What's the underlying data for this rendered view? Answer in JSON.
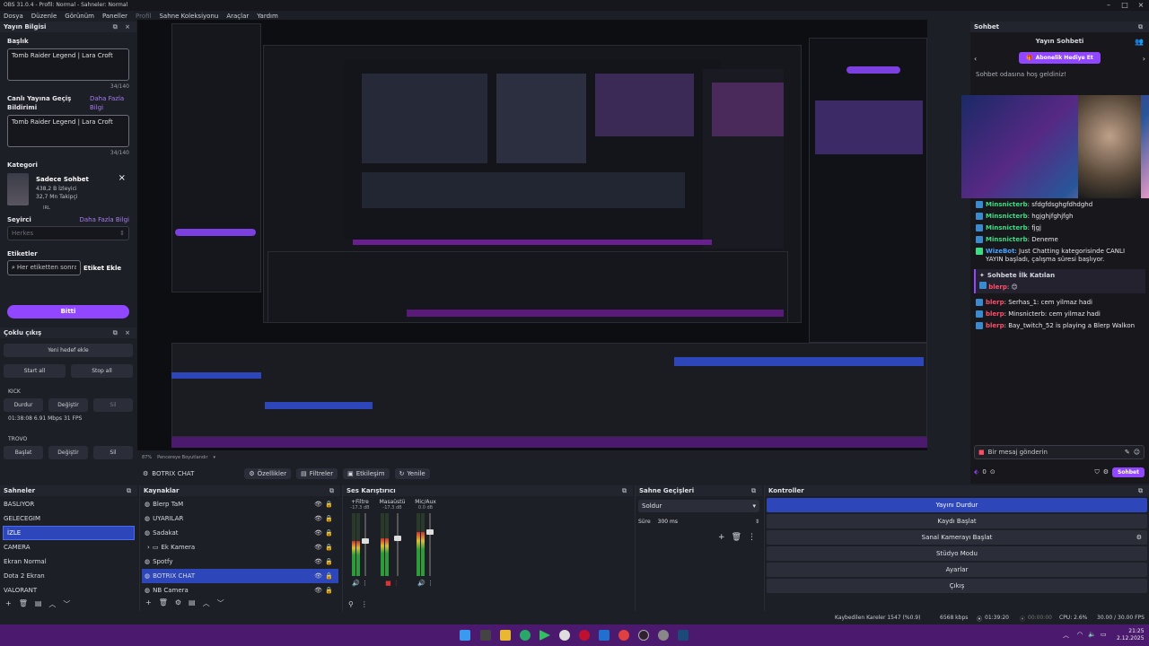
{
  "window": {
    "title": "OBS 31.0.4 - Profil: Normal - Sahneler: Normal"
  },
  "menu": [
    "Dosya",
    "Düzenle",
    "Görünüm",
    "Paneller",
    "Profil",
    "Sahne Koleksiyonu",
    "Araçlar",
    "Yardım"
  ],
  "stream_info": {
    "header": "Yayın Bilgisi",
    "title_label": "Başlık",
    "title_value": "Tomb Raider Legend | Lara Croft",
    "title_count": "34/140",
    "live_label": "Canlı Yayına Geçiş Bildirimi",
    "live_link": "Daha Fazla Bilgi",
    "live_value": "Tomb Raider Legend | Lara Croft",
    "live_count": "34/140",
    "category_label": "Kategori",
    "category_name": "Sadece Sohbet",
    "category_viewers": "438,2 B İzleyici",
    "category_followers": "32,7 Mn Takipçi",
    "category_tag": "IRL",
    "audience_label": "Seyirci",
    "audience_link": "Daha Fazla Bilgi",
    "audience_value": "Herkes",
    "tags_label": "Etiketler",
    "tags_placeholder": "Her etiketten sonra",
    "tags_button": "Etiket Ekle",
    "done_button": "Bitti"
  },
  "multi_output": {
    "header": "Çoklu çıkış",
    "add_target": "Yeni hedef ekle",
    "start_all": "Start all",
    "stop_all": "Stop all",
    "kick_label": "KICK",
    "kick_stop": "Durdur",
    "kick_change": "Değiştir",
    "kick_delete": "Sil",
    "kick_stats": "01:38:08  6.91 Mbps  31 FPS",
    "trovo_label": "TROVO",
    "trovo_start": "Başlat",
    "trovo_change": "Değiştir",
    "trovo_delete": "Sil"
  },
  "preview": {
    "zoom": "87%",
    "zoom_label": "Pencereye Boyutlandır"
  },
  "source_toolbar": {
    "selected_source": "BOTRIX CHAT",
    "properties": "Özellikler",
    "filters": "Filtreler",
    "interact": "Etkileşim",
    "refresh": "Yenile"
  },
  "scenes": {
    "header": "Sahneler",
    "items": [
      "BASLIYOR",
      "GELECEGIM",
      "İZLE",
      "CAMERA",
      "Ekran Normal",
      "Dota 2 Ekran",
      "VALORANT"
    ],
    "selected": 2
  },
  "sources": {
    "header": "Kaynaklar",
    "items": [
      "Blerp TaM",
      "UYARILAR",
      "Sadakat",
      "Ek Kamera",
      "Spotfy",
      "BOTRIX CHAT",
      "NB Camera"
    ],
    "selected": 5
  },
  "mixer": {
    "header": "Ses Karıştırıcı",
    "channels": [
      {
        "name": "+Filtre",
        "db": "-17.3 dB",
        "level": 0.55
      },
      {
        "name": "Masaüstü",
        "db": "-17.3 dB",
        "level": 0.6
      },
      {
        "name": "Mic/Aux",
        "db": "0.0 dB",
        "level": 0.7
      }
    ]
  },
  "transitions": {
    "header": "Sahne Geçişleri",
    "type": "Soldur",
    "duration_label": "Süre",
    "duration_value": "300 ms"
  },
  "controls": {
    "header": "Kontroller",
    "buttons": [
      "Yayını Durdur",
      "Kaydı Başlat",
      "Sanal Kamerayı Başlat",
      "Stüdyo Modu",
      "Ayarlar",
      "Çıkış"
    ]
  },
  "chat": {
    "header": "Sohbet",
    "title": "Yayın Sohbeti",
    "gift_button": "Abonelik Hediye Et",
    "welcome": "Sohbet odasına hoş geldiniz!",
    "messages": [
      {
        "user": "Minsnicterb",
        "text": "sfdgfdsghgfdhdghd",
        "color": "#3ddc84"
      },
      {
        "user": "Minsnicterb",
        "text": "hgjghjfghjfgh",
        "color": "#3ddc84"
      },
      {
        "user": "Minsnicterb",
        "text": "fjgj",
        "color": "#3ddc84"
      },
      {
        "user": "Minsnicterb",
        "text": "Deneme",
        "color": "#3ddc84"
      },
      {
        "user": "WizeBot",
        "text": "Just Chatting kategorisinde CANLI YAYIN başladı, çalışma süresi başlıyor.",
        "color": "#4aa3ff"
      }
    ],
    "first_join_label": "Sohbete İlk Katılan",
    "first_join_user": "blerp",
    "messages2": [
      {
        "user": "blerp",
        "text": "Serhas_1: cem yilmaz hadi",
        "color": "#ff4d6a"
      },
      {
        "user": "blerp",
        "text": "Minsnicterb: cem yilmaz hadi",
        "color": "#ff4d6a"
      },
      {
        "user": "blerp",
        "text": "Bay_twitch_52 is playing a Blerp Walkon",
        "color": "#ff4d6a"
      }
    ],
    "input_placeholder": "Bir mesaj gönderin",
    "points": "0",
    "send_button": "Sohbet"
  },
  "status": {
    "dropped": "Kaybedilen Kareler 1547 (%0.9)",
    "bitrate": "6568 kbps",
    "live_time": "01:39:20",
    "rec_time": "00:00:00",
    "cpu": "CPU: 2.6%",
    "fps": "30.00 / 30.00 FPS"
  },
  "clock": {
    "time": "21:25",
    "date": "2.12.2025"
  }
}
